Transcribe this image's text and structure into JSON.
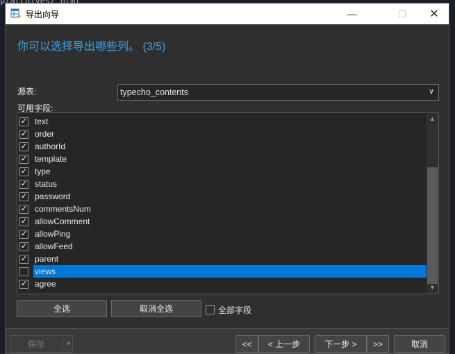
{
  "window": {
    "title": "导出向导"
  },
  "heading": "你可以选择导出哪些列。 (3/5)",
  "source": {
    "label": "源表:",
    "value": "typecho_contents"
  },
  "fields": {
    "label": "可用字段:",
    "items": [
      {
        "name": "text",
        "checked": true
      },
      {
        "name": "order",
        "checked": true
      },
      {
        "name": "authorId",
        "checked": true
      },
      {
        "name": "template",
        "checked": true
      },
      {
        "name": "type",
        "checked": true
      },
      {
        "name": "status",
        "checked": true
      },
      {
        "name": "password",
        "checked": true
      },
      {
        "name": "commentsNum",
        "checked": true
      },
      {
        "name": "allowComment",
        "checked": true
      },
      {
        "name": "allowPing",
        "checked": true
      },
      {
        "name": "allowFeed",
        "checked": true
      },
      {
        "name": "parent",
        "checked": true
      },
      {
        "name": "views",
        "checked": false,
        "selected": true
      },
      {
        "name": "agree",
        "checked": true
      }
    ]
  },
  "buttons": {
    "select_all": "全选",
    "deselect_all": "取消全选",
    "all_fields": "全部字段",
    "save": "保存",
    "first": "<<",
    "prev": "< 上一步",
    "next": "下一步 >",
    "last": ">>",
    "cancel": "取消"
  },
  "colors": {
    "accent": "#3ea3e0",
    "selection": "#0078d7"
  }
}
